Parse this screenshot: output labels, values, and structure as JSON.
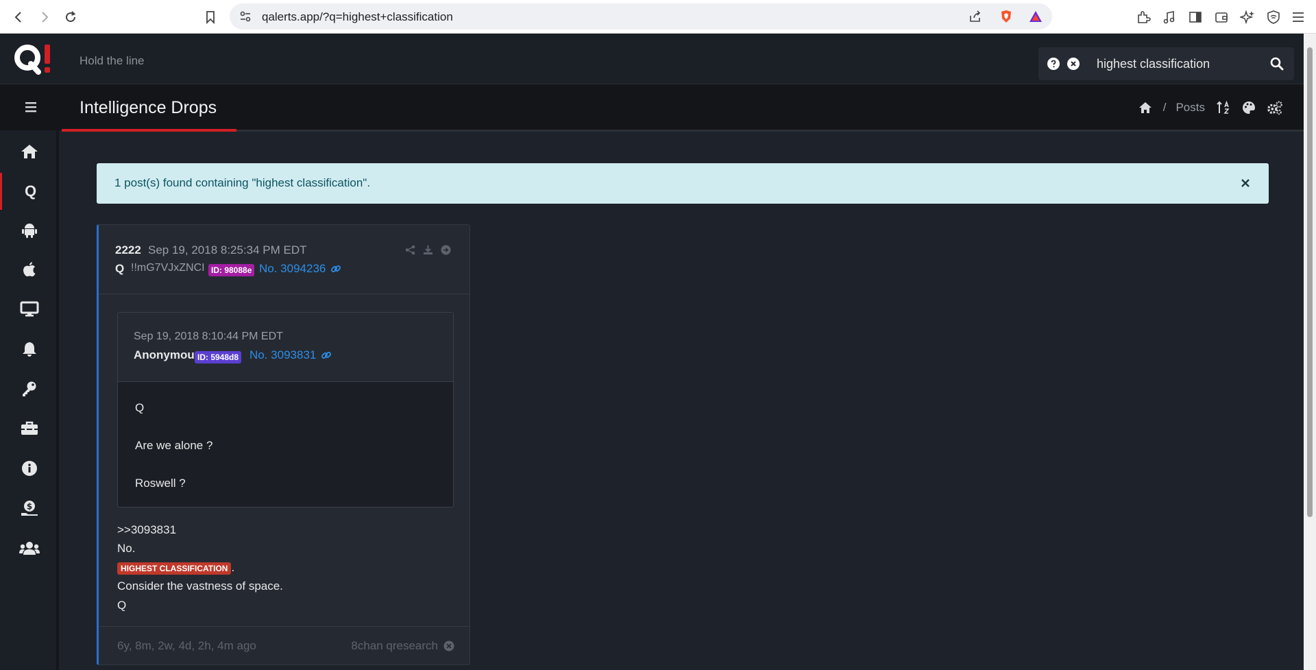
{
  "browser": {
    "url": "qalerts.app/?q=highest+classification"
  },
  "header": {
    "tagline": "Hold the line",
    "search_value": "highest classification"
  },
  "titlebar": {
    "title": "Intelligence Drops",
    "crumb_separator": "/",
    "crumb_posts": "Posts"
  },
  "sidebar": {
    "items": [
      "home-icon",
      "q-icon",
      "android-icon",
      "apple-icon",
      "desktop-icon",
      "bell-icon",
      "key-icon",
      "toolbox-icon",
      "info-icon",
      "donate-icon",
      "users-icon"
    ],
    "q_label": "Q"
  },
  "alert": {
    "message": "1 post(s) found containing \"highest classification\"."
  },
  "post": {
    "number": "2222",
    "date": "Sep 19, 2018 8:25:34 PM EDT",
    "author": "Q",
    "tripcode": "!!mG7VJxZNCI",
    "id_badge": "ID: 98088e",
    "post_no": "No. 3094236",
    "quote": {
      "date": "Sep 19, 2018 8:10:44 PM EDT",
      "author": "Anonymous",
      "id_badge": "ID: 5948d8",
      "post_no": "No. 3093831",
      "lines": [
        "Q",
        "Are we alone ?",
        "Roswell ?"
      ]
    },
    "body": {
      "line1": ">>3093831",
      "line2": "No.",
      "highlight": "HIGHEST CLASSIFICATION",
      "line3_suffix": ".",
      "line4": "Consider the vastness of space.",
      "line5": "Q"
    },
    "footer": {
      "ago": "6y, 8m, 2w, 4d, 2h, 4m ago",
      "source": "8chan qresearch"
    }
  },
  "colors": {
    "accent_red": "#d21f25",
    "link_blue": "#2d8ee8",
    "badge_purple": "#a31fa3",
    "badge_indigo": "#5b3fd1",
    "highlight_red": "#c0392b",
    "alert_bg": "#d1ecf1"
  }
}
